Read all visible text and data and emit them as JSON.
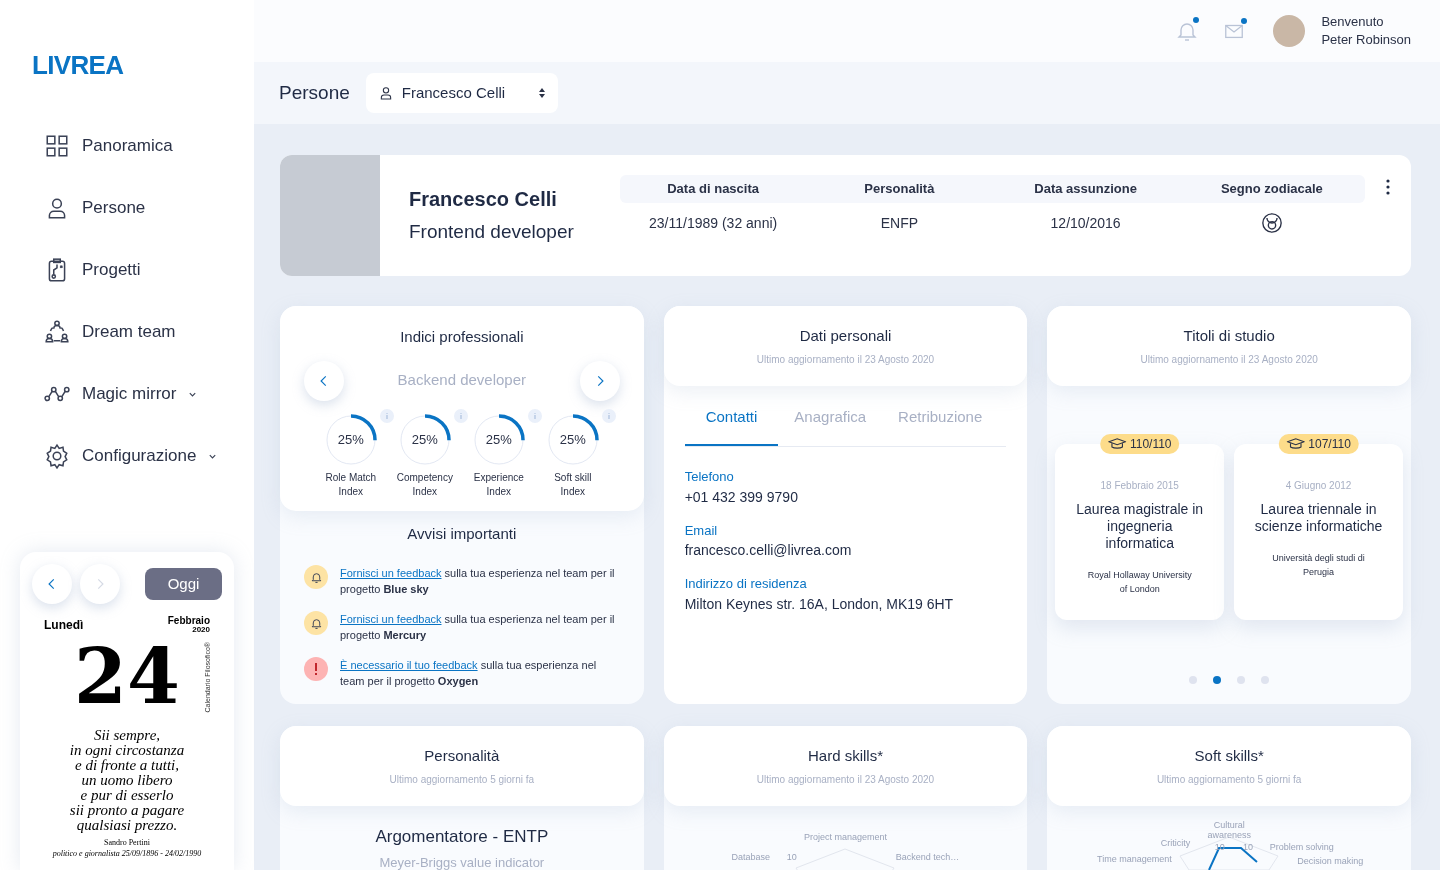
{
  "logo": {
    "text": "LIVREA"
  },
  "nav": [
    {
      "label": "Panoramica",
      "expandable": false
    },
    {
      "label": "Persone",
      "expandable": false
    },
    {
      "label": "Progetti",
      "expandable": false
    },
    {
      "label": "Dream team",
      "expandable": false
    },
    {
      "label": "Magic mirror",
      "expandable": true
    },
    {
      "label": "Configurazione",
      "expandable": true
    }
  ],
  "calendar": {
    "today_button": "Oggi",
    "weekday": "Lunedì",
    "month": "Febbraio",
    "year": "2020",
    "day": "24",
    "brand": "Calendario Filosofico®",
    "quote": [
      "Sii sempre,",
      "in ogni circostanza",
      "e di fronte a tutti,",
      "un uomo libero",
      "e pur di esserlo",
      "sii pronto a pagare",
      "qualsiasi prezzo."
    ],
    "author": "Sandro Pertini",
    "author_note": "politico e giornalista 25/09/1896 - 24/02/1990"
  },
  "topbar": {
    "notifications_unread": true,
    "messages_unread": true,
    "greeting": "Benvenuto",
    "user_name": "Peter Robinson"
  },
  "subheader": {
    "title": "Persone",
    "person_select": "Francesco Celli"
  },
  "profile": {
    "name": "Francesco Celli",
    "role": "Frontend developer",
    "columns": [
      "Data di nascita",
      "Personalità",
      "Data assunzione",
      "Segno zodiacale"
    ],
    "birth_date": "23/11/1989 (32 anni)",
    "personality": "ENFP",
    "hire_date": "12/10/2016"
  },
  "indices": {
    "title": "Indici professionali",
    "role": "Backend developer",
    "items": [
      {
        "value": "25%",
        "label": "Role Match Index",
        "level": 0.25
      },
      {
        "value": "25%",
        "label": "Competency Index",
        "level": 0.25
      },
      {
        "value": "25%",
        "label": "Experience Index",
        "level": 0.25
      },
      {
        "value": "25%",
        "label": "Soft skill Index",
        "level": 0.25
      }
    ]
  },
  "alerts": {
    "title": "Avvisi importanti",
    "items": [
      {
        "kind": "warning",
        "link": "Fornisci un feedback",
        "text": " sulla tua esperienza nel team per il progetto **Blue sky**"
      },
      {
        "kind": "warning",
        "link": "Fornisci un feedback",
        "text": " sulla tua esperienza nel team per il progetto **Mercury**"
      },
      {
        "kind": "error",
        "link": "È necessario il tuo feedback",
        "text": " sulla tua esperienza nel team per il progetto **Oxygen**"
      }
    ]
  },
  "personal_data": {
    "title": "Dati personali",
    "updated": "Ultimo aggiornamento il 23 Agosto 2020",
    "tabs": [
      {
        "label": "Contatti",
        "selected": true
      },
      {
        "label": "Anagrafica",
        "selected": false
      },
      {
        "label": "Retribuzione",
        "selected": false
      }
    ],
    "fields": [
      {
        "label": "Telefono",
        "value": "+01 432 399 9790"
      },
      {
        "label": "Email",
        "value": "francesco.celli@livrea.com"
      },
      {
        "label": "Indirizzo di residenza",
        "value": "Milton Keynes str. 16A, London, MK19 6HT"
      }
    ]
  },
  "education": {
    "title": "Titoli di studio",
    "updated": "Ultimo aggiornamento il 23 Agosto 2020",
    "degrees": [
      {
        "grade": "110/110",
        "date": "18 Febbraio 2015",
        "title": "Laurea magistrale in ingegneria informatica",
        "school": "Royal Hollaway University of London"
      },
      {
        "grade": "107/110",
        "date": "4 Giugno 2012",
        "title": "Laurea triennale in scienze informatiche",
        "school": "Università degli studi di Perugia"
      }
    ],
    "pages": [
      {
        "selected": false
      },
      {
        "selected": true
      },
      {
        "selected": false
      },
      {
        "selected": false
      }
    ]
  },
  "personality": {
    "title": "Personalità",
    "updated": "Ultimo aggiornamento 5 giorni fa",
    "type": "Argomentatore - ENTP",
    "indicator": "Meyer-Briggs value indicator"
  },
  "hard_skills": {
    "title": "Hard skills*",
    "updated": "Ultimo aggiornamento il 23 Agosto 2020",
    "labels": [
      "Project management",
      "Database",
      "10",
      "Backend tech…"
    ]
  },
  "soft_skills": {
    "title": "Soft skills*",
    "updated": "Ultimo aggiornamento 5 giorni fa",
    "labels": [
      "Cultural awareness",
      "Criticity",
      "10",
      "10",
      "Problem solving",
      "Time management",
      "Decision making"
    ]
  }
}
